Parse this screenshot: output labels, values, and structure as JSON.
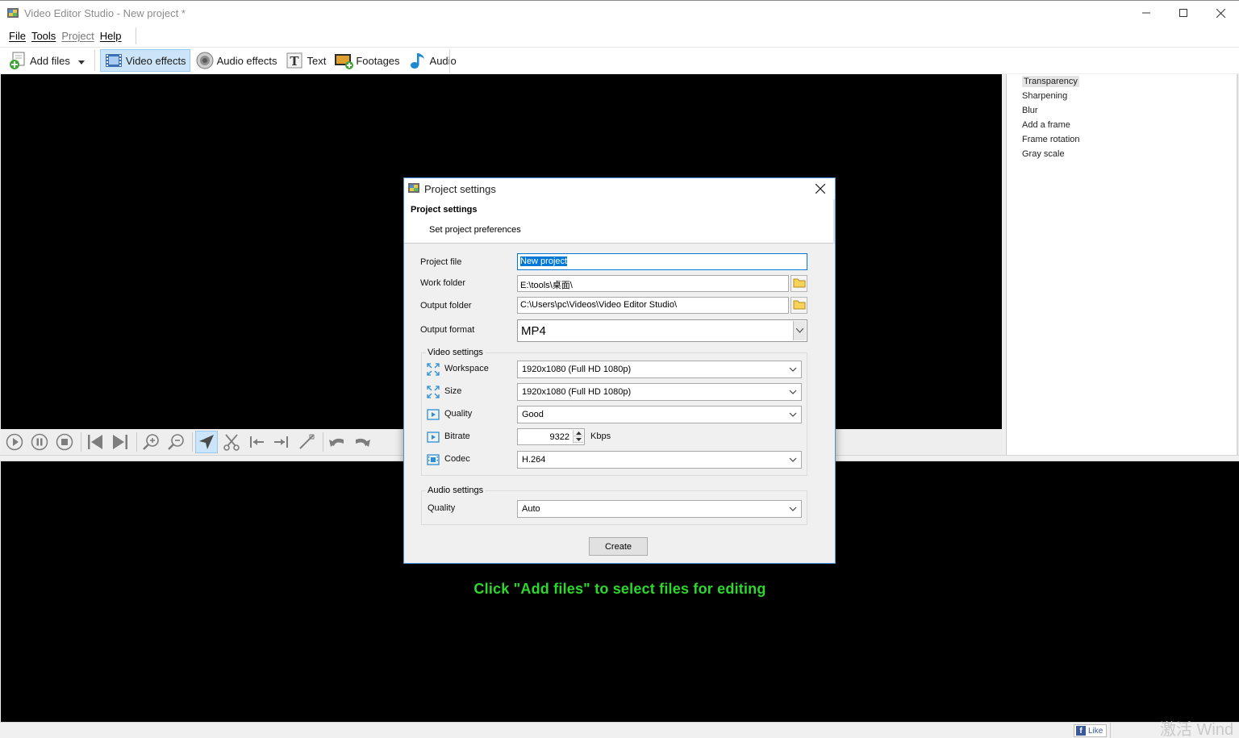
{
  "window": {
    "title": "Video Editor Studio - New project *"
  },
  "menu": [
    {
      "label": "File"
    },
    {
      "label": "Tools"
    },
    {
      "label": "Project"
    },
    {
      "label": "Help"
    }
  ],
  "toolbar": {
    "add_files": "Add files",
    "video_effects": "Video effects",
    "audio_effects": "Audio effects",
    "text": "Text",
    "footages": "Footages",
    "audio": "Audio"
  },
  "effects": [
    {
      "label": "Transparency",
      "selected": true
    },
    {
      "label": "Sharpening"
    },
    {
      "label": "Blur"
    },
    {
      "label": "Add a frame"
    },
    {
      "label": "Frame rotation"
    },
    {
      "label": "Gray scale"
    }
  ],
  "timeline": {
    "hint": "Click \"Add files\"  to select files for editing"
  },
  "statusbar": {
    "like": "Like",
    "watermark": "激活 Wind"
  },
  "dialog": {
    "title": "Project settings",
    "header_title": "Project settings",
    "header_subtitle": "Set project preferences",
    "project_file_label": "Project file",
    "project_file_value": "New project",
    "work_folder_label": "Work folder",
    "work_folder_value": "E:\\tools\\桌面\\",
    "output_folder_label": "Output folder",
    "output_folder_value": "C:\\Users\\pc\\Videos\\Video Editor Studio\\",
    "output_format_label": "Output format",
    "output_format_value": "MP4",
    "video_settings": {
      "title": "Video settings",
      "workspace_label": "Workspace",
      "workspace_value": "1920x1080 (Full HD 1080p)",
      "size_label": "Size",
      "size_value": "1920x1080 (Full HD 1080p)",
      "quality_label": "Quality",
      "quality_value": "Good",
      "bitrate_label": "Bitrate",
      "bitrate_value": "9322",
      "bitrate_unit": "Kbps",
      "codec_label": "Codec",
      "codec_value": "H.264"
    },
    "audio_settings": {
      "title": "Audio settings",
      "quality_label": "Quality",
      "quality_value": "Auto"
    },
    "create_button": "Create"
  },
  "colors": {
    "accent": "#0078d7",
    "hint_green": "#2bd82b",
    "selection": "#cce4f7"
  }
}
